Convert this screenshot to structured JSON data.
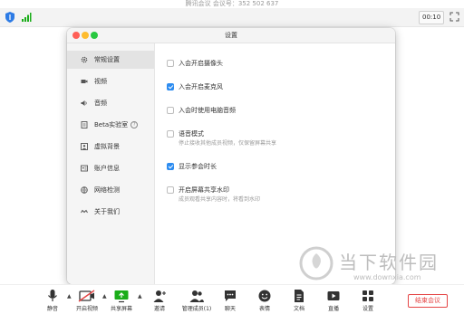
{
  "window": {
    "title": "腾讯会议 会议号：352 502 637"
  },
  "topbar": {
    "timer": "00:10",
    "shield_icon": "shield-icon",
    "signal_icon": "signal-icon",
    "fullscreen_icon": "fullscreen-icon"
  },
  "dialog": {
    "title": "设置"
  },
  "sidebar": {
    "items": [
      {
        "label": "常规设置",
        "icon": "gear-icon",
        "active": true
      },
      {
        "label": "视频",
        "icon": "video-icon"
      },
      {
        "label": "音频",
        "icon": "speaker-icon"
      },
      {
        "label": "Beta实验室",
        "icon": "lab-icon"
      },
      {
        "label": "虚拟背景",
        "icon": "person-icon"
      },
      {
        "label": "账户信息",
        "icon": "account-icon"
      },
      {
        "label": "网络检测",
        "icon": "network-icon"
      },
      {
        "label": "关于我们",
        "icon": "about-icon"
      }
    ]
  },
  "settings": {
    "options": [
      {
        "label": "入会开启摄像头",
        "checked": false
      },
      {
        "label": "入会开启麦克风",
        "checked": true
      },
      {
        "label": "入会时使用电脑音频",
        "checked": false
      },
      {
        "label": "语音模式",
        "desc": "停止接收其他成员视频，仅保留屏幕共享",
        "checked": false
      },
      {
        "label": "显示参会时长",
        "checked": true
      },
      {
        "label": "开启屏幕共享水印",
        "desc": "成员观看共享内容时，将看到水印",
        "checked": false
      }
    ]
  },
  "toolbar": {
    "buttons": [
      {
        "label": "静音",
        "icon": "microphone-icon"
      },
      {
        "label": "开启视频",
        "icon": "camera-off-icon"
      },
      {
        "label": "共享屏幕",
        "icon": "share-screen-icon"
      },
      {
        "label": "邀请",
        "icon": "invite-icon"
      },
      {
        "label": "管理成员(1)",
        "icon": "members-icon"
      },
      {
        "label": "聊天",
        "icon": "chat-icon"
      },
      {
        "label": "表情",
        "icon": "emoji-icon"
      },
      {
        "label": "文档",
        "icon": "document-icon"
      },
      {
        "label": "直播",
        "icon": "live-icon"
      },
      {
        "label": "设置",
        "icon": "settings-grid-icon"
      }
    ],
    "end_label": "结束会议"
  },
  "watermark": {
    "name": "当下软件园",
    "url": "www.downxia.com"
  },
  "colors": {
    "accent": "#2d8cf0",
    "end_red": "#e54545",
    "share_green": "#1aad19"
  }
}
